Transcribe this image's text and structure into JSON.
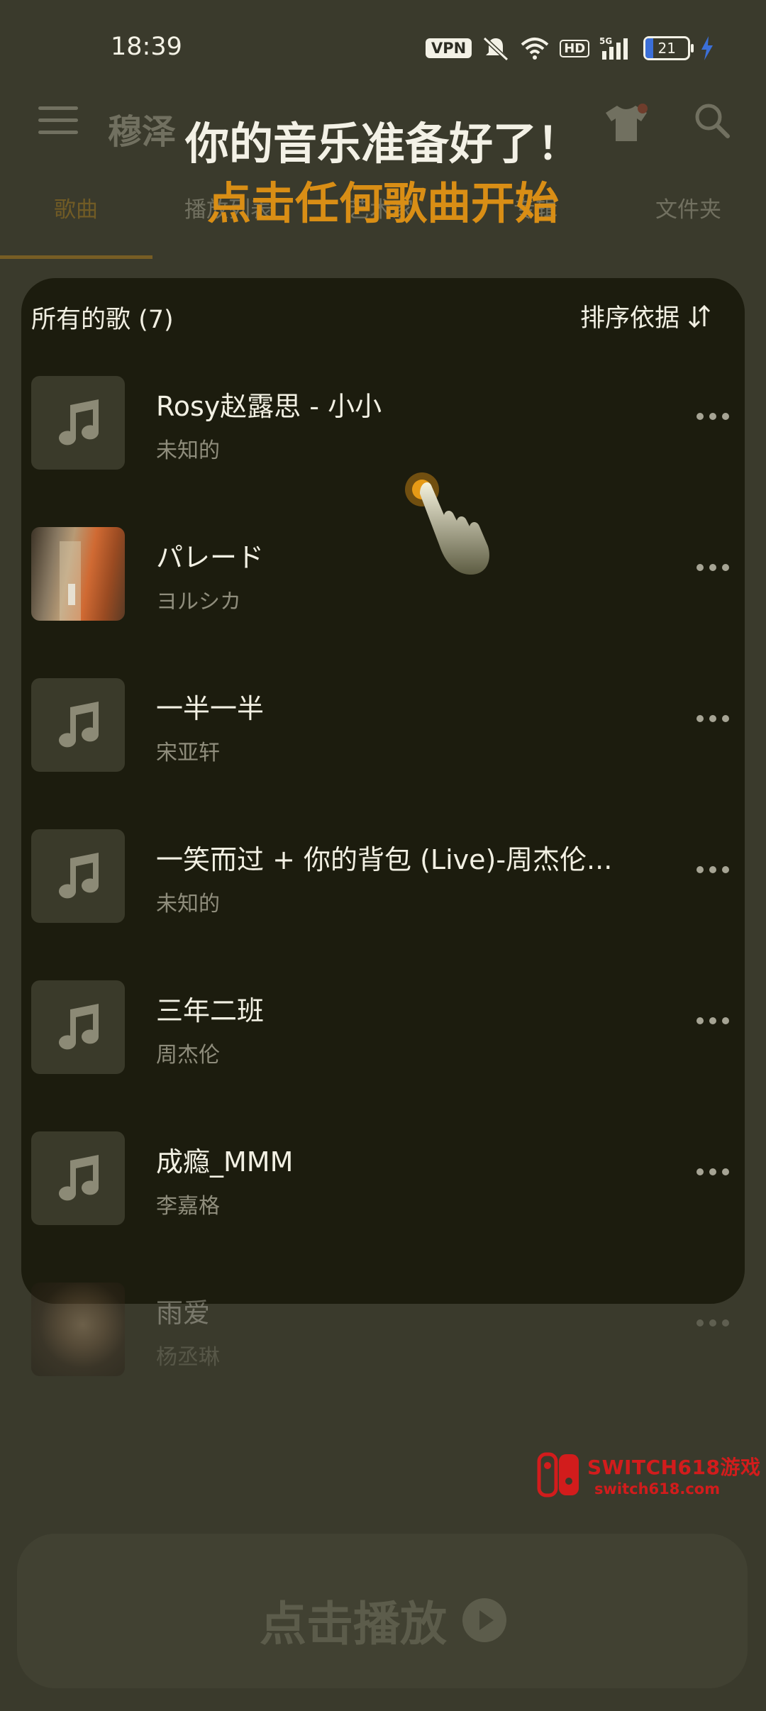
{
  "status_bar": {
    "time": "18:39",
    "vpn": "VPN",
    "hd": "HD",
    "network": "5G",
    "battery": "21"
  },
  "header": {
    "title": "穆泽",
    "menu_icon": "hamburger-icon",
    "theme_icon": "tshirt-icon",
    "search_icon": "search-icon"
  },
  "tabs": [
    "歌曲",
    "播放列表",
    "艺术家",
    "专辑",
    "文件夹"
  ],
  "overlay": {
    "headline": "你的音乐准备好了！",
    "subheadline": "点击任何歌曲开始"
  },
  "list": {
    "heading": "所有的歌 (7)",
    "sort_label": "排序依据",
    "songs": [
      {
        "title": "Rosy赵露思 - 小小",
        "artist": "未知的"
      },
      {
        "title": "パレード",
        "artist": "ヨルシカ"
      },
      {
        "title": "一半一半",
        "artist": "宋亚轩"
      },
      {
        "title": "一笑而过 + 你的背包 (Live)-周杰伦...",
        "artist": "未知的"
      },
      {
        "title": "三年二班",
        "artist": "周杰伦"
      },
      {
        "title": "成瘾_MMM",
        "artist": "李嘉格"
      },
      {
        "title": "雨爱",
        "artist": "杨丞琳"
      }
    ]
  },
  "watermark": {
    "line1": "SWITCH618游戏",
    "line2": "switch618.com"
  },
  "play_bar": {
    "label": "点击播放"
  },
  "colors": {
    "accent": "#d98e15",
    "background": "#3a3a2c",
    "card": "#1c1c0e"
  }
}
